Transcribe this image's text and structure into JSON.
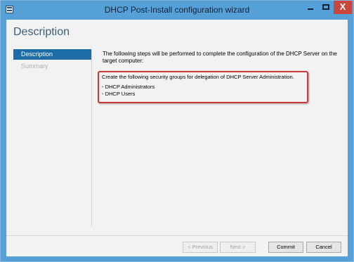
{
  "window": {
    "title": "DHCP Post-Install configuration wizard"
  },
  "controls": {
    "close_glyph": "X"
  },
  "page": {
    "heading": "Description"
  },
  "nav": {
    "items": [
      "Description",
      "Summary"
    ]
  },
  "content": {
    "intro": "The following steps will be performed to complete the configuration of the DHCP Server on the target computer:",
    "box_title": "Create the following security groups for delegation of DHCP Server Administration.",
    "groups": [
      "- DHCP Administrators",
      "- DHCP Users"
    ]
  },
  "buttons": {
    "previous": "< Previous",
    "next": "Next >",
    "commit": "Commit",
    "cancel": "Cancel"
  }
}
